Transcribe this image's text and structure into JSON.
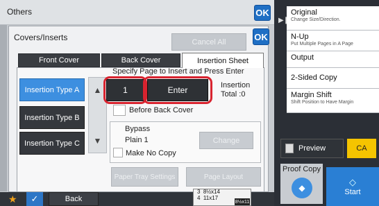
{
  "header": {
    "title": "Others",
    "ok_label": "OK"
  },
  "dialog": {
    "title": "Covers/Inserts",
    "cancel_all_label": "Cancel All",
    "ok_label": "OK",
    "tabs": [
      {
        "label": "Front Cover"
      },
      {
        "label": "Back Cover"
      },
      {
        "label": "Insertion Sheet"
      }
    ],
    "instruction": "Specify Page to Insert and Press Enter",
    "insertion_types": [
      {
        "label": "Insertion Type A"
      },
      {
        "label": "Insertion Type B"
      },
      {
        "label": "Insertion Type C"
      }
    ],
    "page_number": "1",
    "enter_label": "Enter",
    "insertion_label": "Insertion",
    "total_label": "Total :0",
    "before_back_cover_label": "Before Back Cover",
    "paper_source": "Bypass",
    "paper_type": "Plain 1",
    "change_label": "Change",
    "make_no_copy_label": "Make No Copy",
    "paper_tray_settings_label": "Paper Tray Settings",
    "page_layout_label": "Page Layout"
  },
  "bottom": {
    "back_label": "Back",
    "paper_status": [
      {
        "num": "3",
        "size": "8½x14"
      },
      {
        "num": "4",
        "size": "11x17"
      }
    ],
    "paper_status_last": "8½x11"
  },
  "right_panel": {
    "items": [
      {
        "title": "Original",
        "sub": "Change Size/Direction."
      },
      {
        "title": "N-Up",
        "sub": "Put Multiple Pages in A Page"
      },
      {
        "title": "Output",
        "sub": ""
      },
      {
        "title": "2-Sided Copy",
        "sub": ""
      },
      {
        "title": "Margin Shift",
        "sub": "Shift Position to Have Margin"
      }
    ],
    "preview_label": "Preview",
    "ca_label": "CA",
    "proof_copy_label": "Proof Copy",
    "start_label": "Start"
  },
  "colors": {
    "accent": "#3d8fe0",
    "highlight": "#d8232f",
    "ca": "#f5c400"
  }
}
